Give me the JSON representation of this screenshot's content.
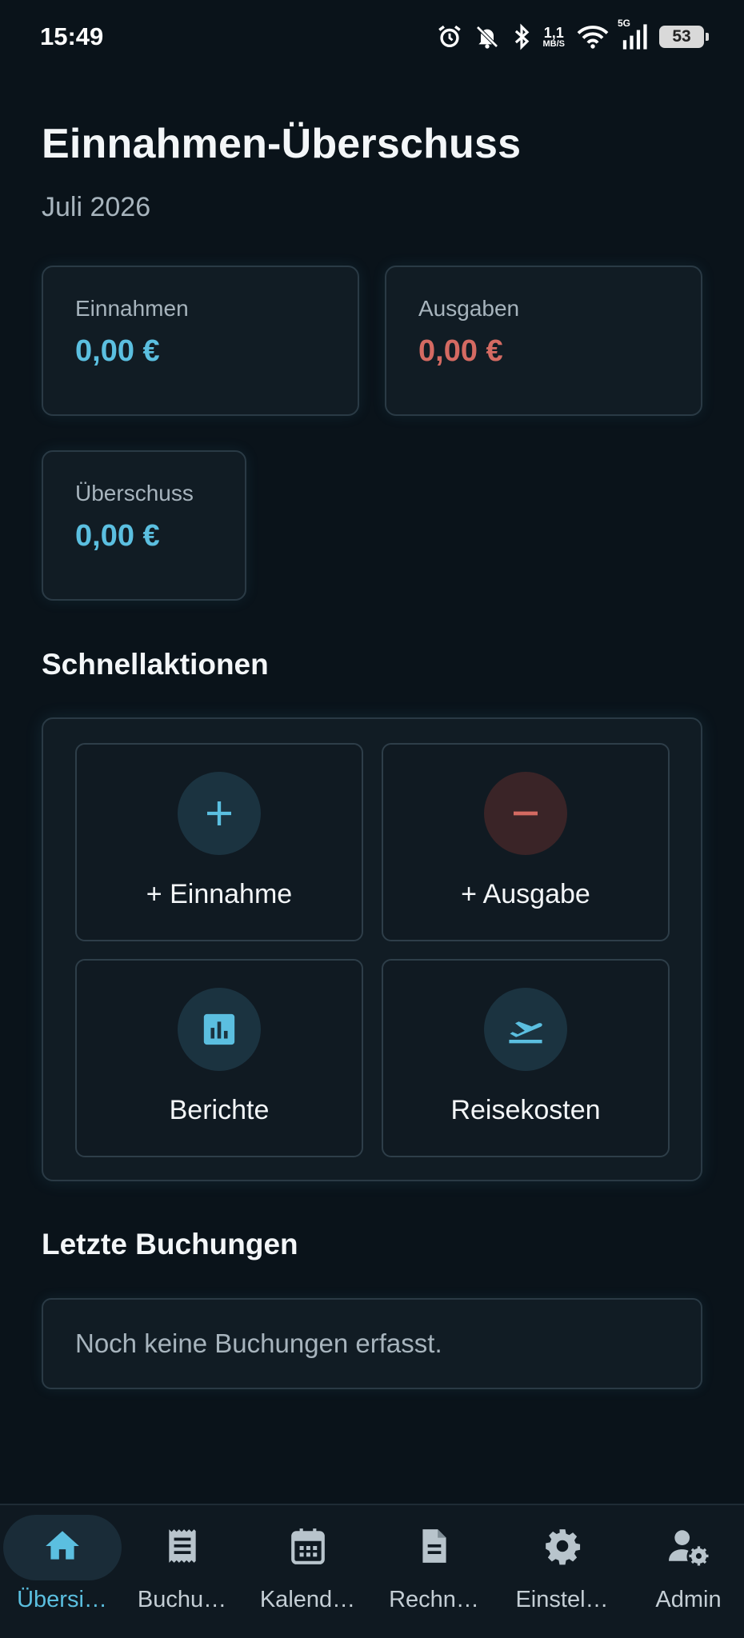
{
  "status_bar": {
    "time": "15:49",
    "net_speed_value": "1,1",
    "net_speed_unit": "MB/S",
    "network_type": "5G",
    "battery": "53"
  },
  "header": {
    "title": "Einnahmen-Überschuss",
    "period": "Juli 2026"
  },
  "summary": {
    "income_label": "Einnahmen",
    "income_value": "0,00 €",
    "expense_label": "Ausgaben",
    "expense_value": "0,00 €",
    "surplus_label": "Überschuss",
    "surplus_value": "0,00 €"
  },
  "quick_actions": {
    "title": "Schnellaktionen",
    "items": [
      {
        "label": "+ Einnahme",
        "icon": "plus-icon"
      },
      {
        "label": "+ Ausgabe",
        "icon": "minus-icon"
      },
      {
        "label": "Berichte",
        "icon": "bar-chart-icon"
      },
      {
        "label": "Reisekosten",
        "icon": "flight-takeoff-icon"
      }
    ]
  },
  "recent_bookings": {
    "title": "Letzte Buchungen",
    "empty_text": "Noch keine Buchungen erfasst."
  },
  "bottom_nav": {
    "items": [
      {
        "label": "Übersi…",
        "icon": "home-icon",
        "active": true
      },
      {
        "label": "Buchu…",
        "icon": "receipt-icon",
        "active": false
      },
      {
        "label": "Kalend…",
        "icon": "calendar-icon",
        "active": false
      },
      {
        "label": "Rechn…",
        "icon": "document-icon",
        "active": false
      },
      {
        "label": "Einstel…",
        "icon": "gear-icon",
        "active": false
      },
      {
        "label": "Admin",
        "icon": "admin-icon",
        "active": false
      }
    ]
  },
  "colors": {
    "background": "#0a131a",
    "accent": "#5bbfe0",
    "expense": "#d46a62",
    "card": "#111c24"
  }
}
